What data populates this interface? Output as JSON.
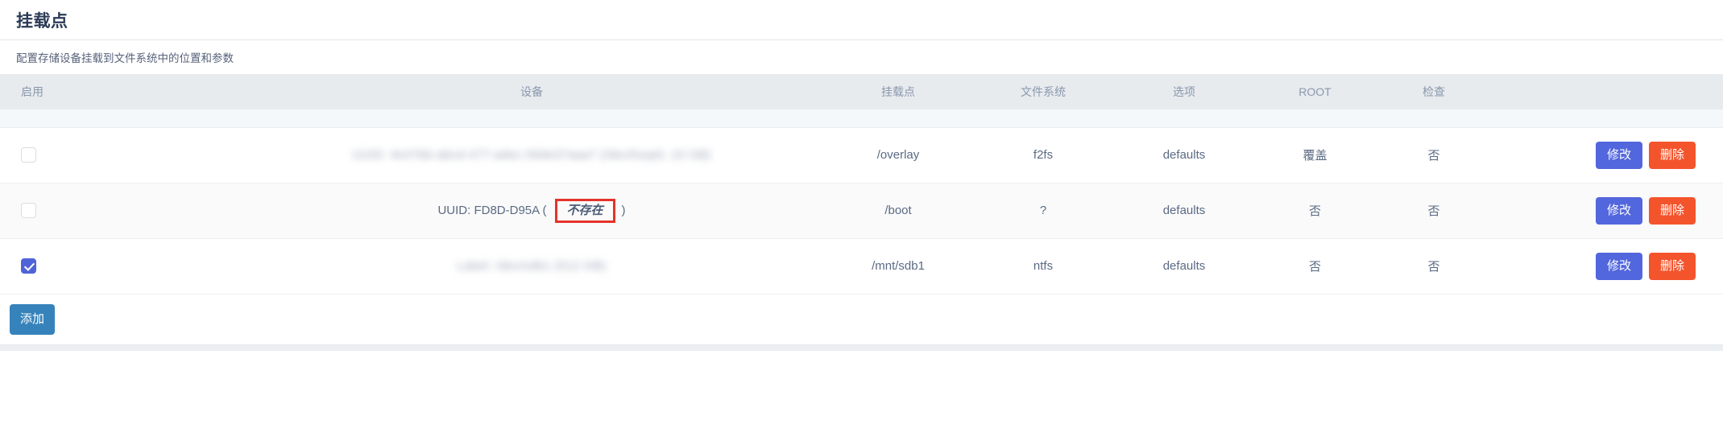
{
  "header": {
    "title": "挂载点",
    "subtitle": "配置存储设备挂载到文件系统中的位置和参数"
  },
  "table": {
    "columns": [
      {
        "key": "enable",
        "label": "启用"
      },
      {
        "key": "device",
        "label": "设备"
      },
      {
        "key": "mount",
        "label": "挂载点"
      },
      {
        "key": "fs",
        "label": "文件系统"
      },
      {
        "key": "options",
        "label": "选项"
      },
      {
        "key": "root",
        "label": "ROOT"
      },
      {
        "key": "check",
        "label": "检查"
      },
      {
        "key": "actions",
        "label": ""
      }
    ],
    "rows": [
      {
        "enabled": false,
        "device_redacted": "UUID: 4e47bb-abcd-477-adec-56de37aaa7 (/dev/loop0, 10 GB)",
        "device_is_redacted": true,
        "device_prefix": "",
        "device_missing_label": "",
        "mount": "/overlay",
        "fs": "f2fs",
        "options": "defaults",
        "root": "覆盖",
        "check": "否",
        "edit_label": "修改",
        "delete_label": "删除"
      },
      {
        "enabled": false,
        "device_redacted": "",
        "device_is_redacted": false,
        "device_prefix": "UUID: FD8D-D95A (",
        "device_missing_label": "不存在",
        "device_suffix": ")",
        "mount": "/boot",
        "fs": "?",
        "options": "defaults",
        "root": "否",
        "check": "否",
        "edit_label": "修改",
        "delete_label": "删除"
      },
      {
        "enabled": true,
        "device_redacted": "Label: /dev/sdb1 (512 GB)",
        "device_is_redacted": true,
        "device_prefix": "",
        "device_missing_label": "",
        "mount": "/mnt/sdb1",
        "fs": "ntfs",
        "options": "defaults",
        "root": "否",
        "check": "否",
        "edit_label": "修改",
        "delete_label": "删除"
      }
    ]
  },
  "footer": {
    "add_label": "添加"
  },
  "colors": {
    "header_bg": "#e7ebee",
    "title_text": "#2b3a55",
    "cell_text": "#5b6a84",
    "edit_button": "#5266dd",
    "delete_button": "#f4542c",
    "add_button": "#3683bb",
    "annotation_red": "#e5332a",
    "checkbox_checked": "#4f63d8"
  }
}
